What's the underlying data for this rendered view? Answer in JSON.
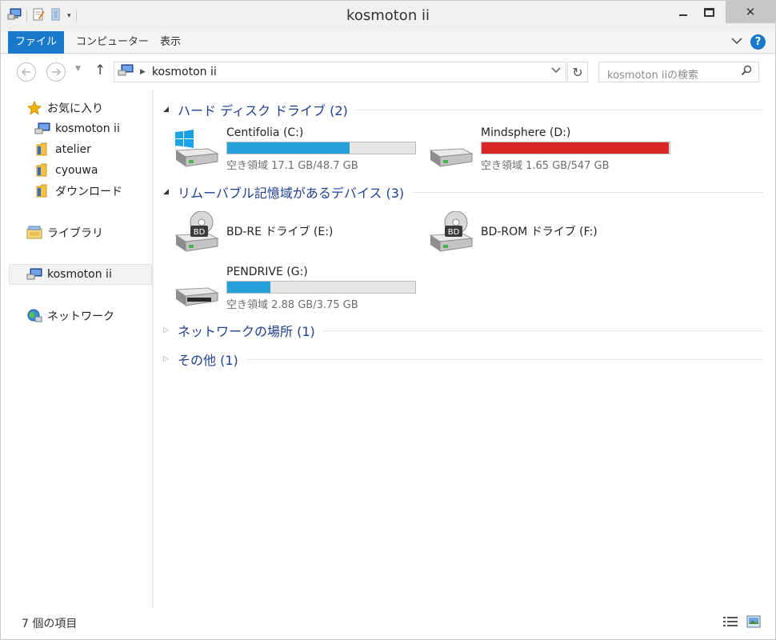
{
  "window": {
    "title": "kosmoton ii",
    "minimize_glyph": "—",
    "close_glyph": "✕"
  },
  "ribbon": {
    "tabs": [
      {
        "label": "ファイル"
      },
      {
        "label": "コンピューター"
      },
      {
        "label": "表示"
      }
    ],
    "help_glyph": "?"
  },
  "nav": {
    "up_glyph": "↑",
    "refresh_glyph": "↻",
    "address_crumb": "kosmoton ii",
    "search_placeholder": "kosmoton iiの検索"
  },
  "sidebar": {
    "favorites_label": "お気に入り",
    "favorites": [
      {
        "label": "kosmoton ii",
        "icon": "computer-icon"
      },
      {
        "label": "atelier",
        "icon": "folder-icon"
      },
      {
        "label": "cyouwa",
        "icon": "folder-icon"
      },
      {
        "label": "ダウンロード",
        "icon": "folder-icon"
      }
    ],
    "libraries_label": "ライブラリ",
    "computer_label": "kosmoton ii",
    "network_label": "ネットワーク"
  },
  "content": {
    "groups": {
      "hdd": "ハード ディスク ドライブ (2)",
      "removable": "リムーバブル記憶域があるデバイス (3)",
      "network": "ネットワークの場所 (1)",
      "other": "その他 (1)"
    },
    "drives": {
      "c": {
        "name": "Centifolia (C:)",
        "free_text": "空き領域 17.1 GB/48.7 GB",
        "used_fraction": 0.65,
        "bar_color": "#26a0da"
      },
      "d": {
        "name": "Mindsphere (D:)",
        "free_text": "空き領域 1.65 GB/547 GB",
        "used_fraction": 0.997,
        "bar_color": "#da2626"
      },
      "e": {
        "name": "BD-RE ドライブ (E:)",
        "disc_label": "BD"
      },
      "f": {
        "name": "BD-ROM ドライブ (F:)",
        "disc_label": "BD"
      },
      "g": {
        "name": "PENDRIVE (G:)",
        "free_text": "空き領域 2.88 GB/3.75 GB",
        "used_fraction": 0.23,
        "bar_color": "#26a0da"
      }
    }
  },
  "status": {
    "item_count": "7 個の項目"
  }
}
